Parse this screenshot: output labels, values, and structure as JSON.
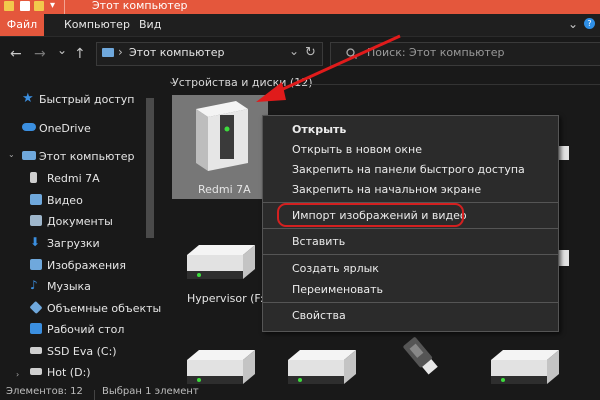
{
  "window": {
    "title": "Этот компьютер",
    "accent": "#e4573c"
  },
  "ribbon": {
    "tabs": [
      "Файл",
      "Компьютер",
      "Вид"
    ]
  },
  "nav": {
    "back": "←",
    "forward": "→",
    "recent": "⌄",
    "up": "↑",
    "address": "Этот компьютер",
    "address_sep": "›",
    "address_dropdown": "⌄",
    "refresh": "↻",
    "search_placeholder": "Поиск: Этот компьютер"
  },
  "sidebar": {
    "items": [
      {
        "label": "Быстрый доступ",
        "icon": "star-icon",
        "color": "#3b8fe0"
      },
      {
        "label": "OneDrive",
        "icon": "cloud-icon",
        "color": "#3b8fe0"
      },
      {
        "label": "Этот компьютер",
        "icon": "computer-icon",
        "color": "#6fa8dc"
      },
      {
        "label": "Redmi 7A",
        "icon": "phone-icon",
        "color": "#cfcfcf"
      },
      {
        "label": "Видео",
        "icon": "video-folder-icon",
        "color": "#6fa8dc"
      },
      {
        "label": "Документы",
        "icon": "documents-folder-icon",
        "color": "#9fb7cc"
      },
      {
        "label": "Загрузки",
        "icon": "downloads-folder-icon",
        "color": "#3b8fe0"
      },
      {
        "label": "Изображения",
        "icon": "pictures-folder-icon",
        "color": "#6fa8dc"
      },
      {
        "label": "Музыка",
        "icon": "music-folder-icon",
        "color": "#3b8fe0"
      },
      {
        "label": "Объемные объекты",
        "icon": "3d-objects-icon",
        "color": "#6fa8dc"
      },
      {
        "label": "Рабочий стол",
        "icon": "desktop-folder-icon",
        "color": "#3b8fe0"
      },
      {
        "label": "SSD Eva (C:)",
        "icon": "drive-icon",
        "color": "#cfcfcf"
      },
      {
        "label": "Hot (D:)",
        "icon": "drive-icon",
        "color": "#cfcfcf"
      }
    ]
  },
  "content": {
    "group_header": "Устройства и диски (12)",
    "selected_device": "Redmi 7A",
    "drive_label": "Hypervisor (F:)"
  },
  "context_menu": {
    "open": "Открыть",
    "open_new_window": "Открыть в новом окне",
    "pin_quick_access": "Закрепить на панели быстрого доступа",
    "pin_start": "Закрепить на начальном экране",
    "import": "Импорт изображений и видео",
    "paste": "Вставить",
    "create_shortcut": "Создать ярлык",
    "rename": "Переименовать",
    "properties": "Свойства"
  },
  "status": {
    "items": "Элементов: 12",
    "selected": "Выбран 1 элемент"
  },
  "colors": {
    "highlight_ring": "#d42020",
    "arrow": "#e01b1b",
    "led": "#3ddc3d"
  }
}
